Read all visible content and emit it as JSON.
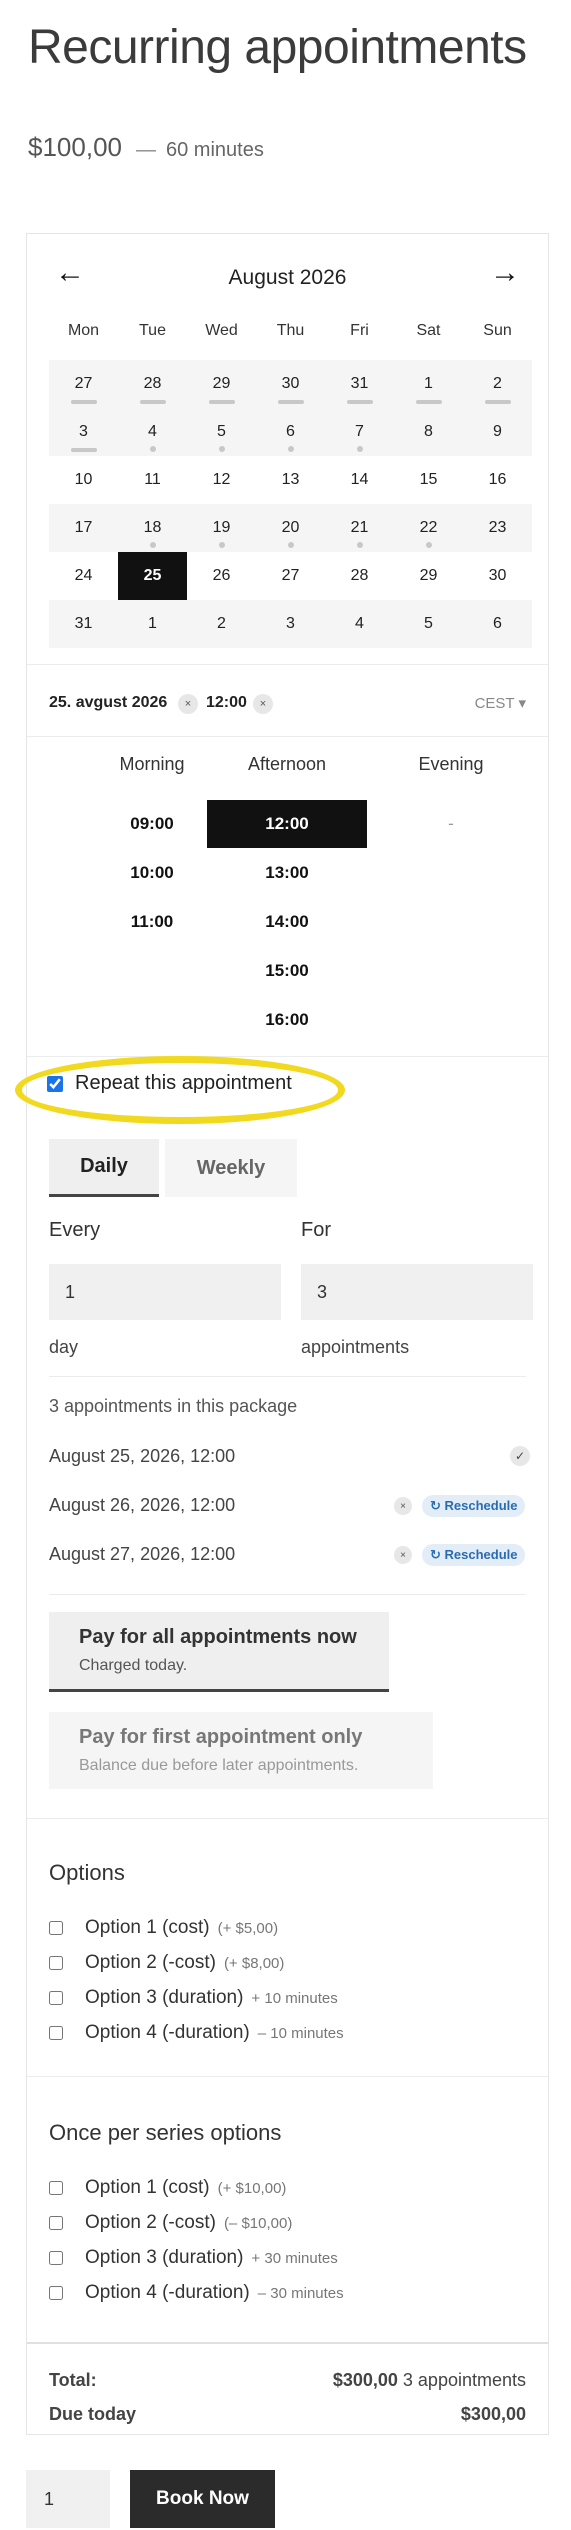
{
  "product": {
    "title": "Recurring appointments",
    "price": "$100,00",
    "separator": "—",
    "duration": "60 minutes"
  },
  "calendar": {
    "prev_arrow": "←",
    "next_arrow": "→",
    "month": "August 2026",
    "weekdays": [
      "Mon",
      "Tue",
      "Wed",
      "Thu",
      "Fri",
      "Sat",
      "Sun"
    ],
    "weeks": [
      [
        "27",
        "28",
        "29",
        "30",
        "31",
        "1",
        "2"
      ],
      [
        "3",
        "4",
        "5",
        "6",
        "7",
        "8",
        "9"
      ],
      [
        "10",
        "11",
        "12",
        "13",
        "14",
        "15",
        "16"
      ],
      [
        "17",
        "18",
        "19",
        "20",
        "21",
        "22",
        "23"
      ],
      [
        "24",
        "25",
        "26",
        "27",
        "28",
        "29",
        "30"
      ],
      [
        "31",
        "1",
        "2",
        "3",
        "4",
        "5",
        "6"
      ]
    ],
    "selected_day": "25"
  },
  "selection": {
    "date": "25. avgust 2026",
    "time": "12:00",
    "remove_symbol": "×",
    "timezone": "CEST ▾"
  },
  "slots": {
    "periods": [
      "Morning",
      "Afternoon",
      "Evening"
    ],
    "morning": [
      "09:00",
      "10:00",
      "11:00"
    ],
    "afternoon": [
      "12:00",
      "13:00",
      "14:00",
      "15:00",
      "16:00"
    ],
    "evening_empty": "-",
    "selected": "12:00"
  },
  "repeat": {
    "label": "Repeat this appointment",
    "checked": true,
    "tabs": [
      "Daily",
      "Weekly"
    ],
    "every_label": "Every",
    "every_value": "1",
    "every_unit": "day",
    "for_label": "For",
    "for_value": "3",
    "for_unit": "appointments"
  },
  "package": {
    "title": "3 appointments in this package",
    "check_symbol": "✓",
    "reschedule_label": "↻ Reschedule",
    "appointments": [
      "August 25, 2026, 12:00",
      "August 26, 2026, 12:00",
      "August 27, 2026, 12:00"
    ]
  },
  "payment": {
    "all_title": "Pay for all appointments now",
    "all_sub": "Charged today.",
    "first_title": "Pay for first appointment only",
    "first_sub": "Balance due before later appointments."
  },
  "options": {
    "title": "Options",
    "items": [
      {
        "name": "Option 1 (cost)",
        "extra": "(+ $5,00)"
      },
      {
        "name": "Option 2 (-cost)",
        "extra": "(+ $8,00)"
      },
      {
        "name": "Option 3 (duration)",
        "extra": "+ 10 minutes"
      },
      {
        "name": "Option 4 (-duration)",
        "extra": "– 10 minutes"
      }
    ]
  },
  "series_options": {
    "title": "Once per series options",
    "items": [
      {
        "name": "Option 1 (cost)",
        "extra": "(+ $10,00)"
      },
      {
        "name": "Option 2 (-cost)",
        "extra": "(– $10,00)"
      },
      {
        "name": "Option 3 (duration)",
        "extra": "+ 30 minutes"
      },
      {
        "name": "Option 4 (-duration)",
        "extra": "– 30 minutes"
      }
    ]
  },
  "totals": {
    "total_label": "Total:",
    "total_value": "$300,00",
    "total_note": "3 appointments",
    "due_label": "Due today",
    "due_value": "$300,00"
  },
  "booking": {
    "quantity": "1",
    "button": "Book Now"
  }
}
